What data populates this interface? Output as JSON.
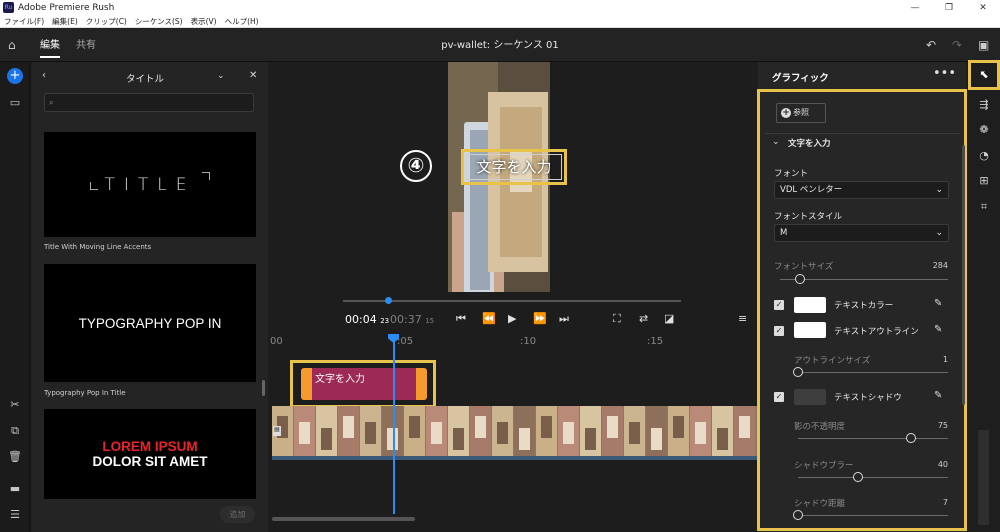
{
  "window": {
    "title": "Adobe Premiere Rush",
    "app_logo": "Ru"
  },
  "menu": [
    "ファイル(F)",
    "編集(E)",
    "クリップ(C)",
    "シーケンス(S)",
    "表示(V)",
    "ヘルプ(H)"
  ],
  "tabs": {
    "edit": "編集",
    "share": "共有"
  },
  "sequence_title": "pv-wallet: シーケンス 01",
  "title_panel": {
    "header": "タイトル",
    "items": [
      {
        "preview_text": "TITLE",
        "caption": "Title With Moving Line Accents"
      },
      {
        "preview_text": "TYPOGRAPHY POP IN",
        "caption": "Typography Pop In Title"
      },
      {
        "preview_line1": "LOREM IPSUM",
        "preview_line2": "DOLOR SIT AMET"
      }
    ],
    "add_button": "追加"
  },
  "preview": {
    "overlay_text": "文字を入力",
    "step_marker": "④"
  },
  "transport": {
    "timecode": "00:04",
    "timecode_frames": "23",
    "duration": "00:37",
    "duration_frames": "15"
  },
  "ruler": {
    "labels": [
      "00",
      ":05",
      ":10",
      ":15"
    ]
  },
  "timeline": {
    "title_clip_label": "文字を入力"
  },
  "graphics_panel": {
    "title": "グラフィック",
    "browse": "参照",
    "section": "文字を入力",
    "font_label": "フォント",
    "font_value": "VDL ペンレター",
    "font_style_label": "フォントスタイル",
    "font_style_value": "M",
    "font_size_label": "フォントサイズ",
    "font_size_value": "284",
    "text_color_label": "テキストカラー",
    "text_outline_label": "テキストアウトライン",
    "outline_size_label": "アウトラインサイズ",
    "outline_size_value": "1",
    "text_shadow_label": "テキストシャドウ",
    "shadow_opacity_label": "影の不透明度",
    "shadow_opacity_value": "75",
    "shadow_blur_label": "シャドウブラー",
    "shadow_blur_value": "40",
    "shadow_distance_label": "シャドウ距離",
    "shadow_distance_value": "7"
  },
  "sliders": {
    "font_size": 0.12,
    "outline_size": 0.0,
    "shadow_opacity": 0.75,
    "shadow_blur": 0.4,
    "shadow_distance": 0.0
  },
  "colors": {
    "accent_blue": "#2d8cf0",
    "highlight_yellow": "#e8c34a",
    "clip_orange": "#f59a2c",
    "clip_magenta": "#9d2a55",
    "lorem_red": "#e8252b"
  }
}
